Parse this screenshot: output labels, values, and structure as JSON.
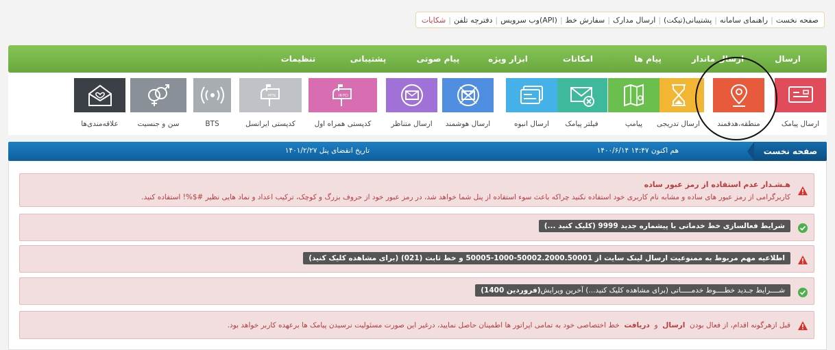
{
  "toplinks": [
    {
      "label": "صفحه نخست"
    },
    {
      "label": "راهنمای سامانه"
    },
    {
      "label": "پشتیبانی(تیکت)"
    },
    {
      "label": "ارسال مدارک"
    },
    {
      "label": "سفارش خط"
    },
    {
      "label": "وب سرویس(API)"
    },
    {
      "label": "دفترچه تلفن"
    },
    {
      "label": "شکایات",
      "color": "#c04040"
    }
  ],
  "menu": [
    {
      "label": "ارسال"
    },
    {
      "label": "ارسال ماندار"
    },
    {
      "label": "پیام ها"
    },
    {
      "label": "امکانات"
    },
    {
      "label": "ابزار ویژه"
    },
    {
      "label": "پیام صوتی"
    },
    {
      "label": "پشتیبانی"
    },
    {
      "label": "تنظیمات"
    }
  ],
  "tiles": [
    {
      "label": "ارسال پیامک",
      "color": "#e04c5b",
      "icon": "sms-card-icon"
    },
    {
      "label": "منطقه،هدفمند",
      "color": "#e85a3c",
      "icon": "location-pin-icon"
    },
    {
      "label": "ارسال تدریجی",
      "color": "#f2b534",
      "icon": "hourglass-icon"
    },
    {
      "label": "پیامپ",
      "color": "#6bbf4e",
      "icon": "map-pin-icon"
    },
    {
      "label": "فیلتر پیامک",
      "color": "#3fb99b",
      "icon": "mail-blocked-icon"
    },
    {
      "label": "ارسال انبوه",
      "color": "#44b1e8",
      "icon": "bulk-card-icon"
    },
    {
      "label": "ارسال هوشمند",
      "color": "#4f8ee0",
      "icon": "smart-mail-icon"
    },
    {
      "label": "ارسال متناظر",
      "color": "#a071d6",
      "icon": "envelope-icon"
    },
    {
      "label": "کدپستی همراه اول",
      "color": "#d96db1",
      "icon": "mailbox-mci-icon"
    },
    {
      "label": "کدپستی ایرانسل",
      "color": "#bfc3c7",
      "icon": "mailbox-mtn-icon"
    },
    {
      "label": "BTS",
      "color": "#a8adb2",
      "icon": "antenna-icon"
    },
    {
      "label": "سن و جنسیت",
      "color": "#8a9097",
      "icon": "gender-icon"
    },
    {
      "label": "علاقه‌مندی‌ها",
      "color": "#3b3f46",
      "icon": "heart-mail-icon"
    }
  ],
  "mailbox_tags": {
    "mci": "IR-TCI",
    "mtn": "MTN"
  },
  "infobar": {
    "home": "صفحه نخست",
    "now": "هم اکنون ۱۴:۴۷ ۱۴۰۰/۶/۱۴",
    "expire": "تاریخ انقضای پنل ۱۴۰۱/۲/۲۷"
  },
  "alerts": {
    "a1_title": "هـشـدار عدم استفاده از رمز عبور ساده",
    "a1_text": "کاربرگرامی از رمز عبور های ساده و مشابه نام کاربری خود استفاده نکنید چراکه باعث سوء استفاده از پنل شما خواهد شد، در رمز عبور خود از حروف بزرگ و کوچک، ترکیب اعداد و نماد هایی نظیر #$%! استفاده کنید.",
    "a2_text": "شرایط فعالسازی خط خدماتی با پیشماره جدید  9999 (کلیک کنید ...)",
    "a3_text": "اطلاعیه مهم مربوط به ممنوعیت ارسال لینک سایت از 50002.2000.50001-1000-50005 و خط ثابت (021) (برای مشاهده کلیک کنید)",
    "a4_text_a": "شــــرایط جـدید خطــــوط خدمـــــاتی (برای مشاهده کلیک کنید...) آخرین ویرایش",
    "a4_text_b": "(فروردین 1400)",
    "a5_pre": "قبل ازهرگونه اقدام، از فعال بودن",
    "a5_send": "ارسال",
    "a5_and": "و",
    "a5_recv": "دریافت",
    "a5_post": "خط اختصاصی خود به تمامی اپراتور ها اطمینان حاصل نمایید، درغیر این صورت مسئولیت نرسیدن پیامک ها برعهده کاربر خواهد بود."
  }
}
